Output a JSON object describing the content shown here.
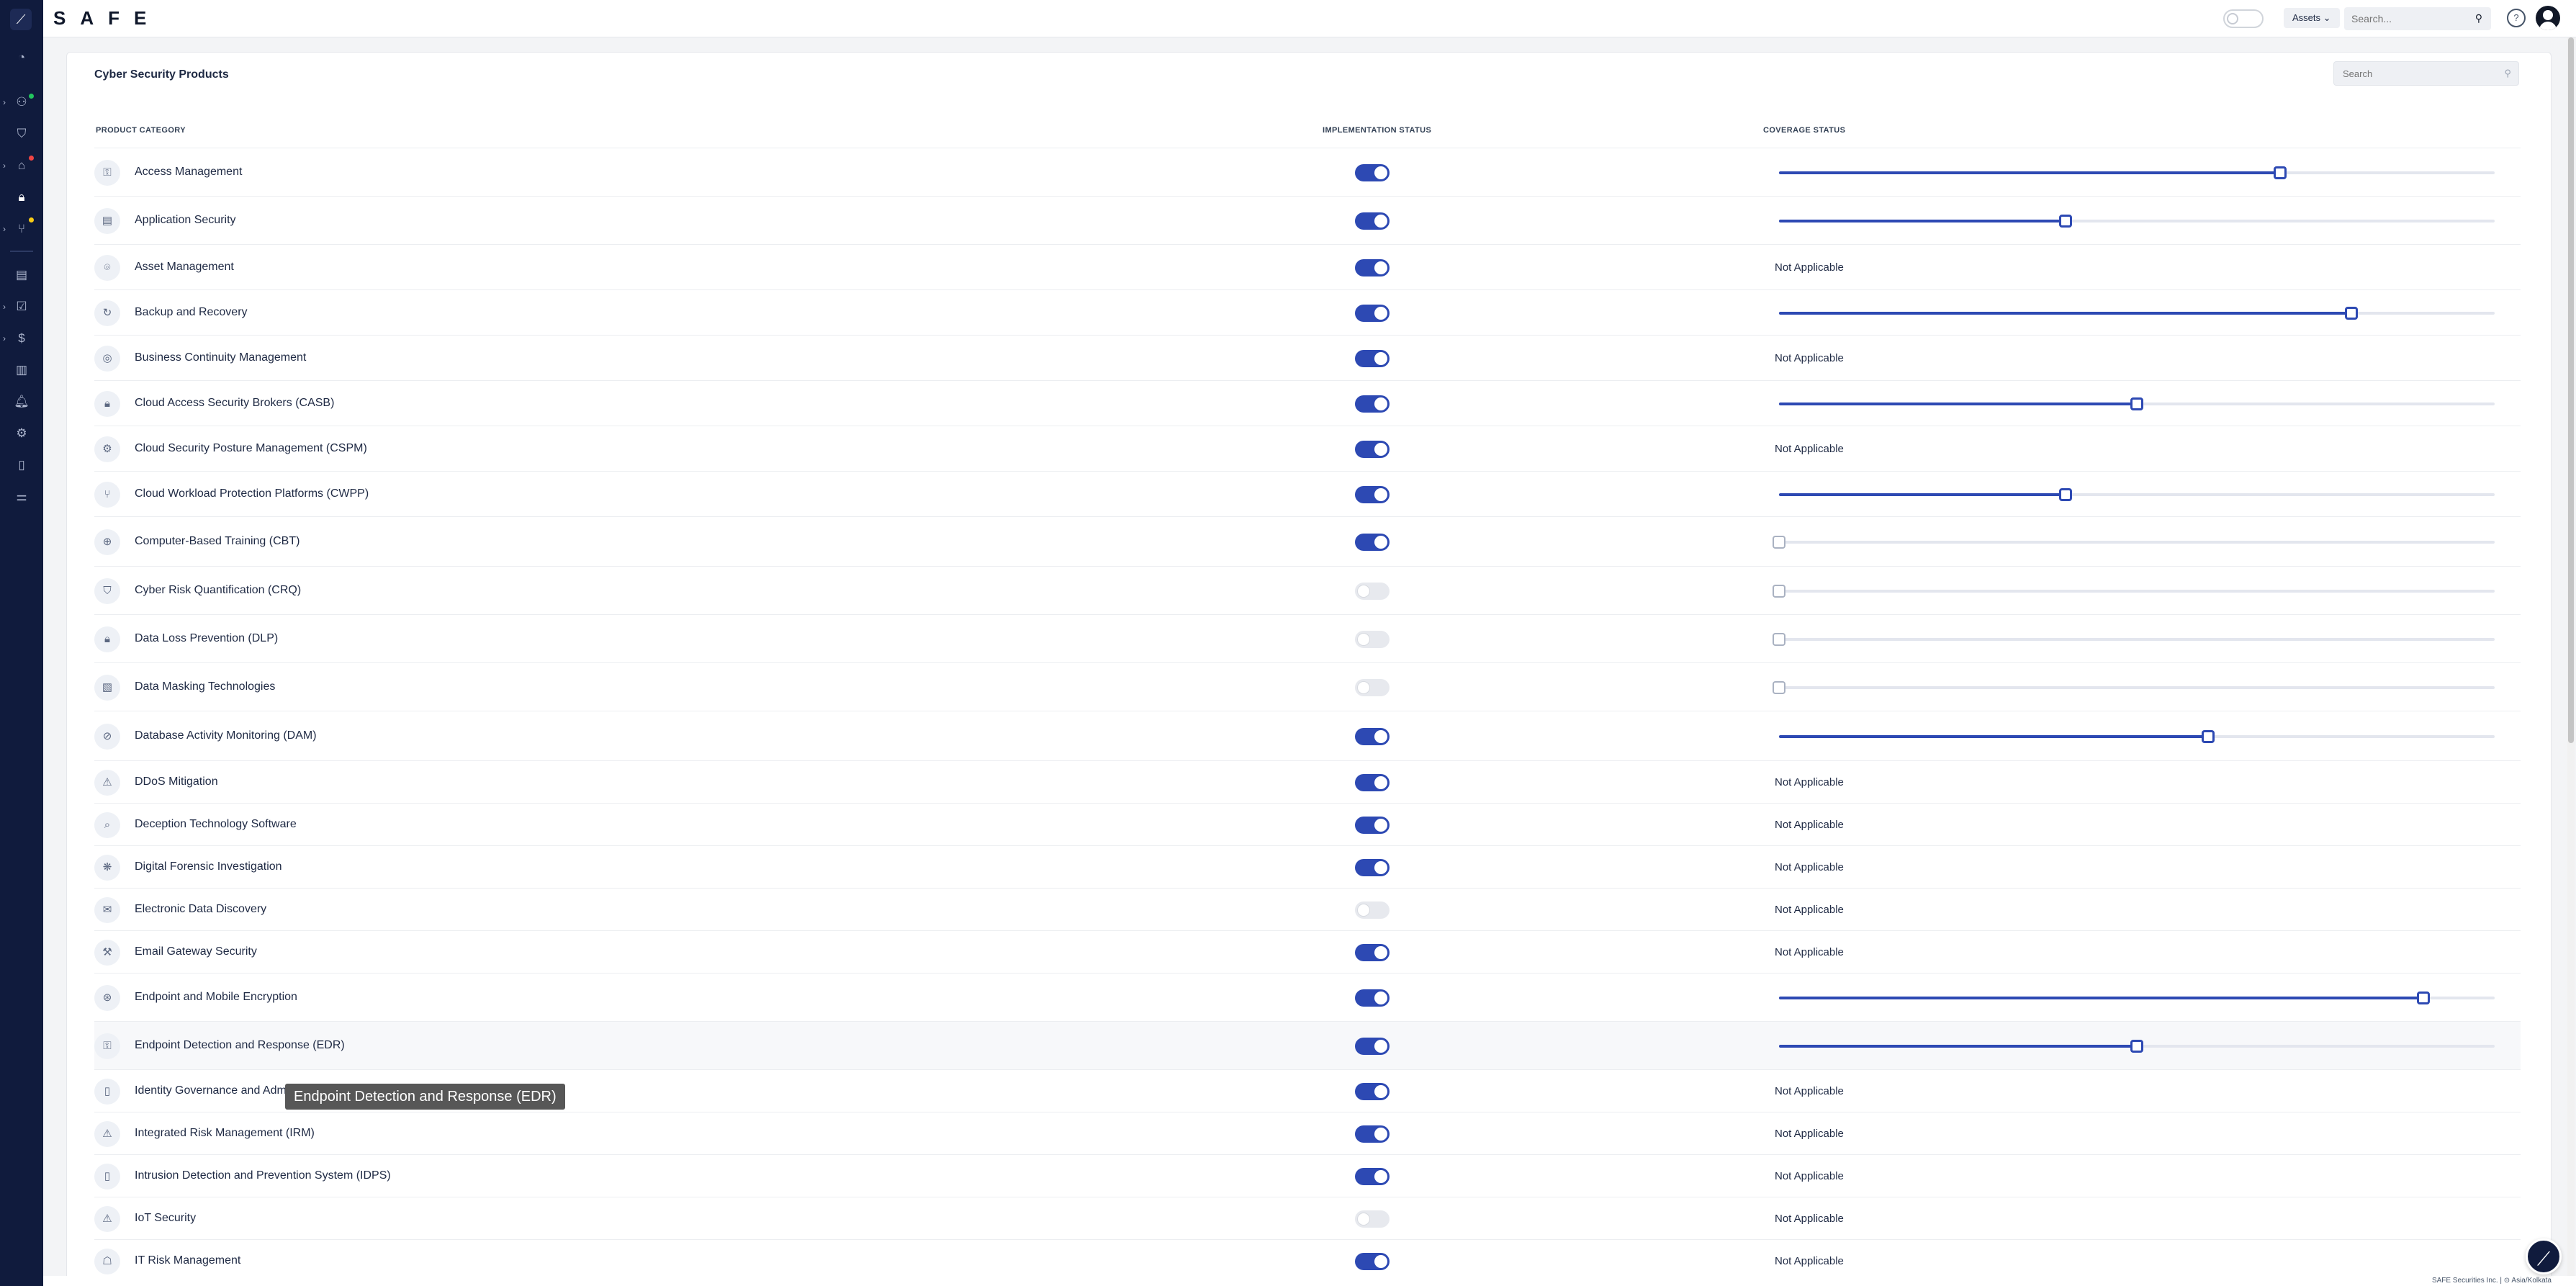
{
  "app": {
    "brand": "SAFE"
  },
  "topbar": {
    "assets_label": "Assets",
    "search_placeholder": "Search..."
  },
  "card": {
    "title": "Cyber Security Products",
    "search_placeholder": "Search",
    "columns": {
      "category": "PRODUCT CATEGORY",
      "implementation": "IMPLEMENTATION STATUS",
      "coverage": "COVERAGE STATUS"
    }
  },
  "not_applicable_label": "Not Applicable",
  "rows": [
    {
      "name": "Access Management",
      "icon": "key-icon",
      "glyph": "⚿",
      "implemented": true,
      "coverage": 70
    },
    {
      "name": "Application Security",
      "icon": "app-icon",
      "glyph": "▤",
      "implemented": true,
      "coverage": 40
    },
    {
      "name": "Asset Management",
      "icon": "asset-icon",
      "glyph": "⌾",
      "implemented": true,
      "coverage": null
    },
    {
      "name": "Backup and Recovery",
      "icon": "backup-icon",
      "glyph": "↻",
      "implemented": true,
      "coverage": 80
    },
    {
      "name": "Business Continuity Management",
      "icon": "continuity-icon",
      "glyph": "◎",
      "implemented": true,
      "coverage": null
    },
    {
      "name": "Cloud Access Security Brokers (CASB)",
      "icon": "lock-icon",
      "glyph": "🔒︎",
      "implemented": true,
      "coverage": 50
    },
    {
      "name": "Cloud Security Posture Management (CSPM)",
      "icon": "gear-icon",
      "glyph": "⚙",
      "implemented": true,
      "coverage": null
    },
    {
      "name": "Cloud Workload Protection Platforms (CWPP)",
      "icon": "network-icon",
      "glyph": "⑂",
      "implemented": true,
      "coverage": 40
    },
    {
      "name": "Computer-Based Training (CBT)",
      "icon": "globe-icon",
      "glyph": "⊕",
      "implemented": true,
      "coverage": 0
    },
    {
      "name": "Cyber Risk Quantification (CRQ)",
      "icon": "shield-icon",
      "glyph": "⛉",
      "implemented": false,
      "coverage": 0
    },
    {
      "name": "Data Loss Prevention (DLP)",
      "icon": "lock-icon",
      "glyph": "🔒︎",
      "implemented": false,
      "coverage": 0
    },
    {
      "name": "Data Masking Technologies",
      "icon": "mask-icon",
      "glyph": "▧",
      "implemented": false,
      "coverage": 0
    },
    {
      "name": "Database Activity Monitoring (DAM)",
      "icon": "database-icon",
      "glyph": "⊘",
      "implemented": true,
      "coverage": 60
    },
    {
      "name": "DDoS Mitigation",
      "icon": "warning-icon",
      "glyph": "⚠",
      "implemented": true,
      "coverage": null
    },
    {
      "name": "Deception Technology Software",
      "icon": "search-icon",
      "glyph": "⌕",
      "implemented": true,
      "coverage": null
    },
    {
      "name": "Digital Forensic Investigation",
      "icon": "fingerprint-icon",
      "glyph": "❋",
      "implemented": true,
      "coverage": null
    },
    {
      "name": "Electronic Data Discovery",
      "icon": "mail-icon",
      "glyph": "✉",
      "implemented": false,
      "coverage": null
    },
    {
      "name": "Email Gateway Security",
      "icon": "gavel-icon",
      "glyph": "⚒",
      "implemented": true,
      "coverage": null
    },
    {
      "name": "Endpoint and Mobile Encryption",
      "icon": "encryption-icon",
      "glyph": "⊛",
      "implemented": true,
      "coverage": 90
    },
    {
      "name": "Endpoint Detection and Response (EDR)",
      "icon": "detect-icon",
      "glyph": "⚿",
      "implemented": true,
      "coverage": 50
    },
    {
      "name": "Identity Governance and Administration",
      "icon": "id-card-icon",
      "glyph": "▯",
      "implemented": true,
      "coverage": null
    },
    {
      "name": "Integrated Risk Management (IRM)",
      "icon": "warning-icon",
      "glyph": "⚠",
      "implemented": true,
      "coverage": null
    },
    {
      "name": "Intrusion Detection and Prevention System (IDPS)",
      "icon": "mobile-icon",
      "glyph": "▯",
      "implemented": true,
      "coverage": null
    },
    {
      "name": "IoT Security",
      "icon": "warning-icon",
      "glyph": "⚠",
      "implemented": false,
      "coverage": null
    },
    {
      "name": "IT Risk Management",
      "icon": "thumb-icon",
      "glyph": "☖",
      "implemented": true,
      "coverage": null
    }
  ],
  "tooltip": {
    "text": "Endpoint Detection and Response (EDR)"
  },
  "footer": {
    "text": "SAFE Securities Inc. | ⊙ Asia/Kolkata"
  }
}
